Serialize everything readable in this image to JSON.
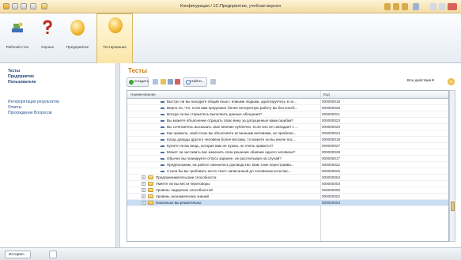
{
  "window": {
    "title": "Конфигурация / 1С:Предприятие, учебная версия"
  },
  "ribbon": {
    "buttons": [
      {
        "label": "Рабочий стол",
        "icon": "desk-icon"
      },
      {
        "label": "Оценка",
        "icon": "question-mark-icon"
      },
      {
        "label": "Предприятие",
        "icon": "circle-icon"
      },
      {
        "label": "Тестирование",
        "icon": "circle-icon"
      }
    ],
    "active": "Тестирование"
  },
  "left_panel": {
    "sections": [
      "Тесты",
      "Предприятие",
      "Пользователи"
    ],
    "links": [
      "Интерпретация результатов",
      "Ответы",
      "Прохождение Вопросов"
    ]
  },
  "form": {
    "title": "Тесты",
    "toolbar": {
      "create_label": "Создать",
      "find_label": "Найти...",
      "all_actions_label": "Все действия"
    },
    "columns": {
      "name": "Наименование",
      "code": "Код"
    },
    "rows": [
      {
        "name": "Быстро ли вы находите общий язык с новыми людьми, адаптируетесь в но...",
        "code": "000000018",
        "type": "item"
      },
      {
        "name": "Верно ли, что, если вам предложат более интересную работу вы без колеб...",
        "code": "000000026",
        "type": "item"
      },
      {
        "name": "Всегда ли вы стараетесь выполнить данные обещания?",
        "code": "000000021",
        "type": "item"
      },
      {
        "name": "Вы можете объяснение отрицать свою вину за допущенные вами ошибки?",
        "code": "000000023",
        "type": "item"
      },
      {
        "name": "Вы сочетаетесь высказать свое мнение публично, если оно не совпадает с ...",
        "code": "000000020",
        "type": "item"
      },
      {
        "name": "Как правило, свой отказ вы объясняете истинными мотивами, не прибегая...",
        "code": "000000024",
        "type": "item"
      },
      {
        "name": "Когда доводы другого человека более весомы, то можете ли вы иначе пос...",
        "code": "000000019",
        "type": "item"
      },
      {
        "name": "Купите ли вы вещь, которая вам не нужна, но очень нравится?",
        "code": "000000027",
        "type": "item"
      },
      {
        "name": "Может ли заставить вас изменить свои решение обаяние одного человека?",
        "code": "000000028",
        "type": "item"
      },
      {
        "name": "Обычно вы планируете отпуск заранее, не рассчитывая на случай?",
        "code": "000000017",
        "type": "item"
      },
      {
        "name": "Предположим, на работе сменилось руководство. Вам тоже перестраива...",
        "code": "000000022",
        "type": "item"
      },
      {
        "name": "Стали бы вы требовать нечто текст написанный до человеком если вас...",
        "code": "000000025",
        "type": "item"
      },
      {
        "name": "Предпринимательские способности",
        "code": "000000004",
        "type": "group"
      },
      {
        "name": "Умеете ли вы вести переговоры",
        "code": "000000003",
        "type": "group"
      },
      {
        "name": "Уровень лидерских способностей",
        "code": "000000005",
        "type": "group"
      },
      {
        "name": "Уровень экономических знаний",
        "code": "000000002",
        "type": "group"
      },
      {
        "name": "Насколько вы решительны",
        "code": "000000004",
        "type": "group",
        "selected": true
      }
    ]
  },
  "statusbar": {
    "history_label": "История..."
  }
}
